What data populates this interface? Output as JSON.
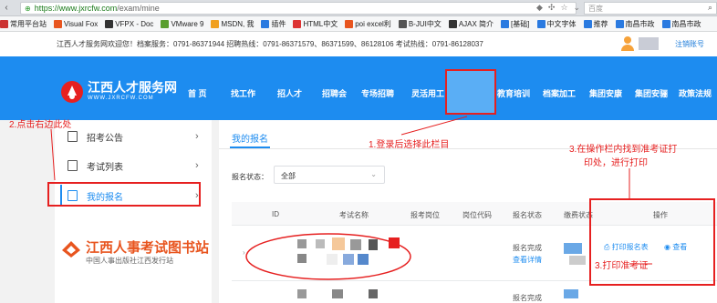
{
  "browser": {
    "url_host": "https://www.jxrcfw.com",
    "url_path": "/exam/mine",
    "search_placeholder": "百度"
  },
  "bookmarks": [
    {
      "label": "常用平台站",
      "color": "#c33"
    },
    {
      "label": "Visual Fox",
      "color": "#e8551f"
    },
    {
      "label": "VFPX - Doc",
      "color": "#333"
    },
    {
      "label": "VMware 9",
      "color": "#5a9e2f"
    },
    {
      "label": "MSDN, 我",
      "color": "#f0a020"
    },
    {
      "label": "插件",
      "color": "#2a7ae0"
    },
    {
      "label": "HTML中文",
      "color": "#d33"
    },
    {
      "label": "poi excel利",
      "color": "#e8551f"
    },
    {
      "label": "B-JUI中文",
      "color": "#555"
    },
    {
      "label": "AJAX 简介",
      "color": "#333"
    },
    {
      "label": "[基础]",
      "color": "#2a7ae0"
    },
    {
      "label": "中文字体",
      "color": "#2a7ae0"
    },
    {
      "label": "推荐",
      "color": "#2a7ae0"
    },
    {
      "label": "南昌市政",
      "color": "#2a7ae0"
    },
    {
      "label": "南昌市政",
      "color": "#2a7ae0"
    }
  ],
  "infobar": {
    "hotline": "江西人才服务网欢迎您！档案服务：0791-86371944  招聘热线：0791-86371579、86371599、86128106  考试热线：0791-86128037",
    "logout": "注销账号"
  },
  "brand": {
    "name": "江西人才服务网",
    "domain": "WWW.JXRCFW.COM"
  },
  "nav": {
    "items": [
      "首 页",
      "找工作",
      "招人才",
      "招聘会",
      "专场招聘",
      "灵活用工",
      "招考专栏",
      "教育培训",
      "档案加工",
      "集团安康",
      "集团安骊",
      "政策法规"
    ]
  },
  "sidebar": {
    "items": [
      {
        "label": "招考公告"
      },
      {
        "label": "考试列表"
      },
      {
        "label": "我的报名"
      }
    ]
  },
  "banner": {
    "title": "江西人事考试图书站",
    "subtitle": "中国人事出版社江西发行站"
  },
  "main": {
    "tab": "我的报名",
    "filter_label": "报名状态：",
    "filter_value": "全部",
    "columns": [
      "ID",
      "考试名称",
      "报考岗位",
      "岗位代码",
      "报名状态",
      "缴费状态",
      "操作"
    ],
    "rows": [
      {
        "status": "报名完成",
        "detail_link": "查看详情",
        "op_print_form": "打印报名表",
        "op_view": "查看"
      },
      {
        "status": "报名完成",
        "detail_link": "",
        "op_print_form": "",
        "op_view": ""
      }
    ]
  },
  "annotations": {
    "a1": "1.登录后选择此栏目",
    "a2": "2.点击右边此处",
    "a3_line1": "3.在操作栏内找到准考证打",
    "a3_line2": "印处，进行打印",
    "a4": "3.打印准考证"
  },
  "colors": {
    "nav_blue": "#1d8cf0",
    "highlight_red": "#e62020",
    "banner_orange": "#e8551f"
  }
}
